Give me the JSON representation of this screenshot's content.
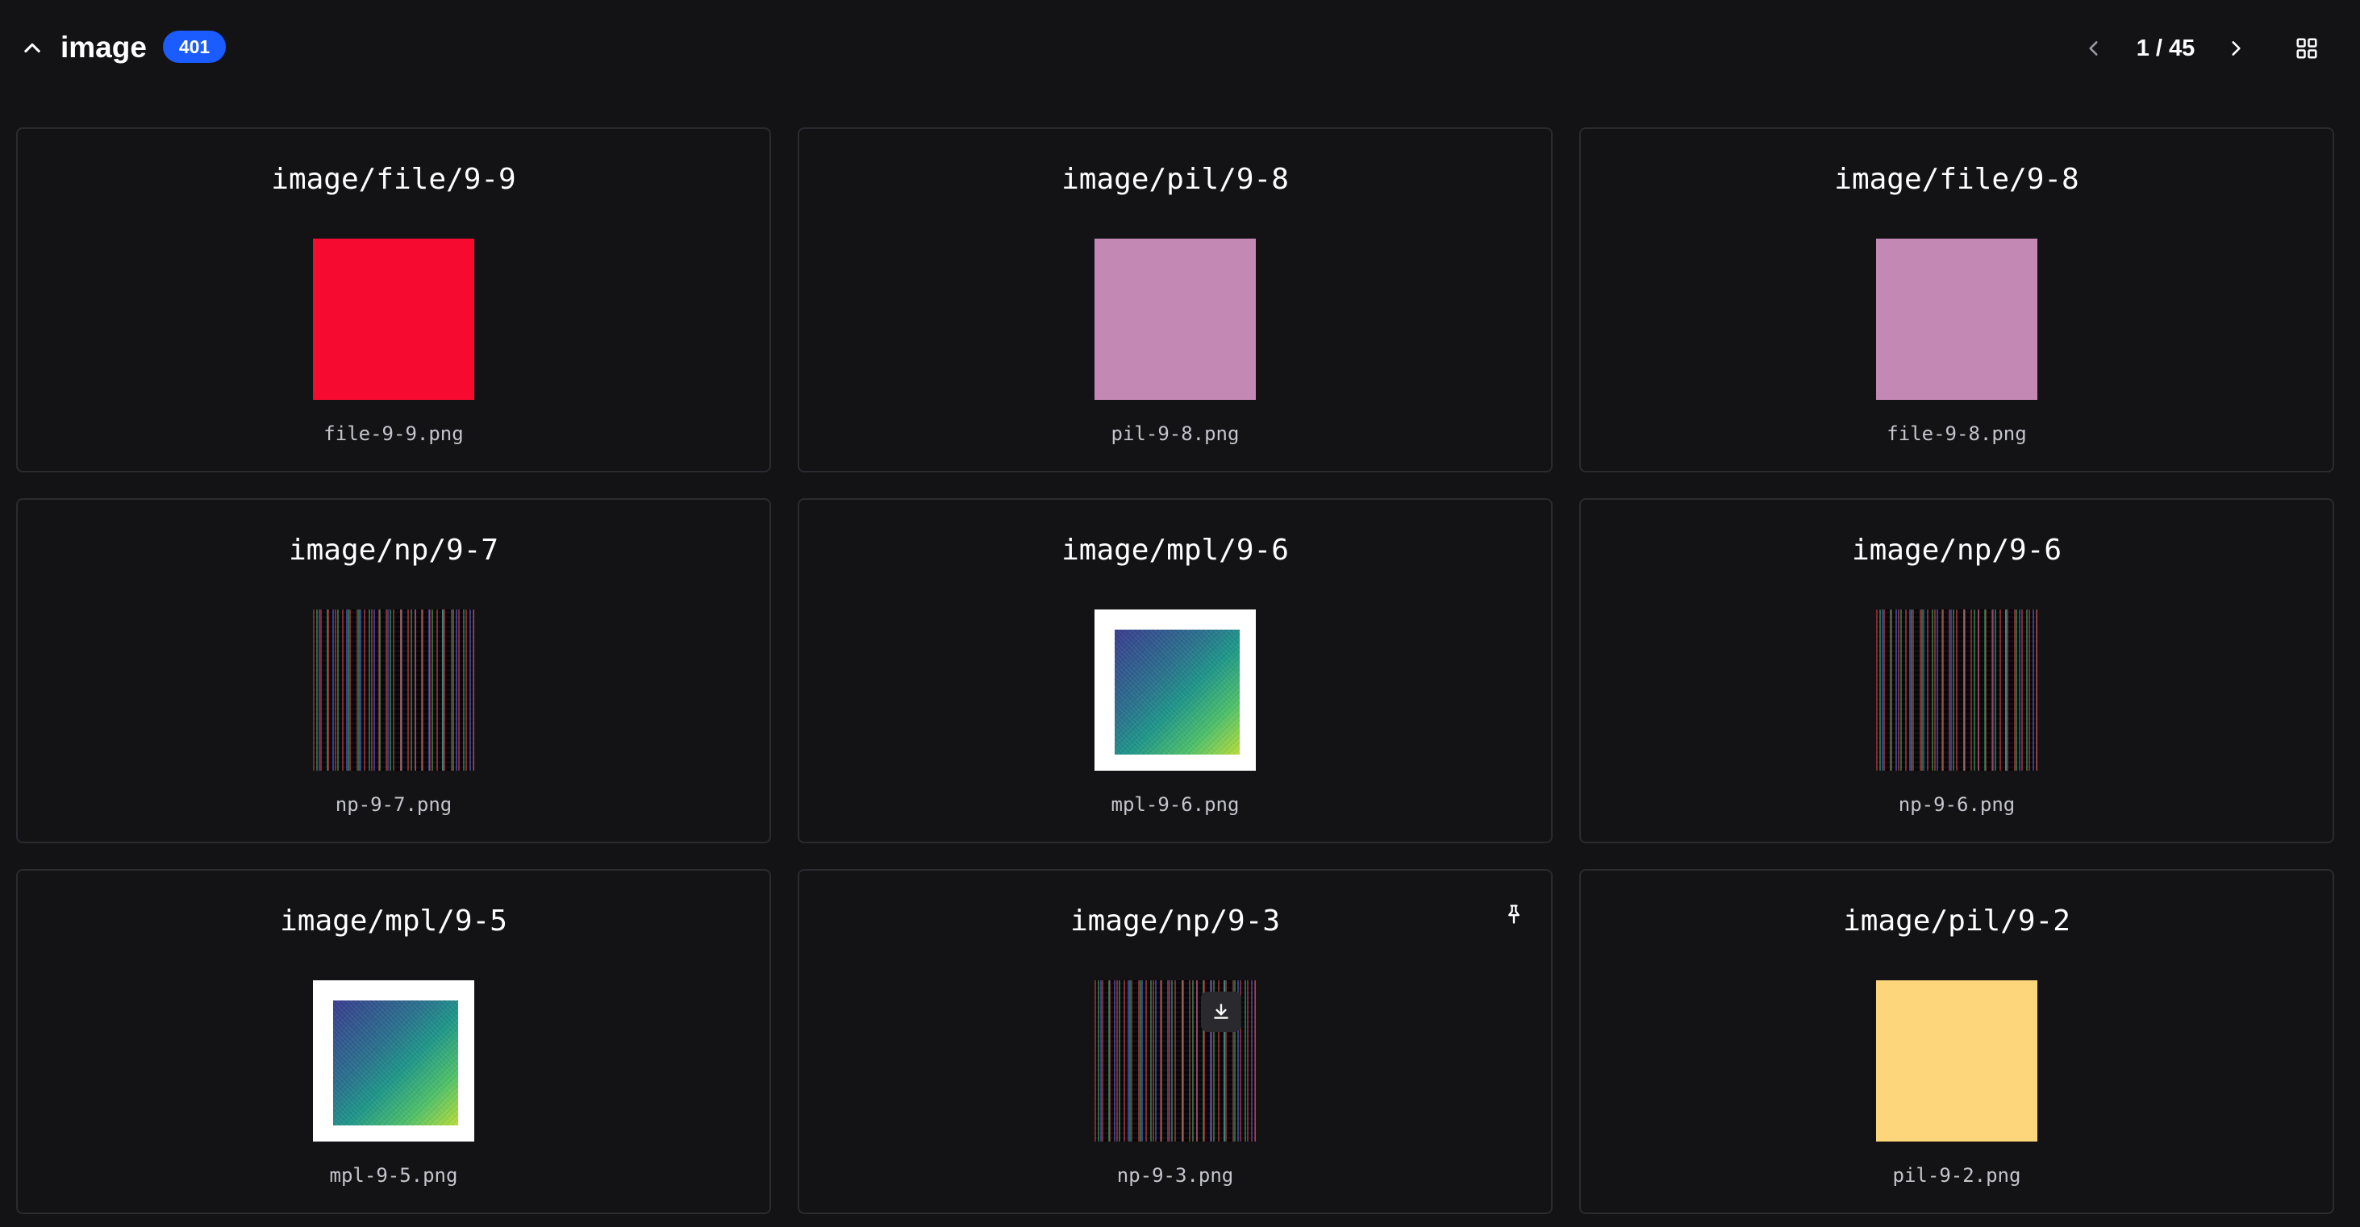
{
  "header": {
    "section_title": "image",
    "count": "401",
    "page_indicator": "1 / 45",
    "accent_color": "#1a5cff"
  },
  "icons": {
    "collapse": "chevron-up-icon",
    "prev": "chevron-left-icon",
    "next": "chevron-right-icon",
    "layout": "grid-icon",
    "pin": "pin-icon",
    "download": "download-icon"
  },
  "cards": [
    {
      "title": "image/file/9-9",
      "caption": "file-9-9.png",
      "kind": "solid",
      "color": "#f70a30"
    },
    {
      "title": "image/pil/9-8",
      "caption": "pil-9-8.png",
      "kind": "solid",
      "color": "#c488b5"
    },
    {
      "title": "image/file/9-8",
      "caption": "file-9-8.png",
      "kind": "solid",
      "color": "#c488b5"
    },
    {
      "title": "image/np/9-7",
      "caption": "np-9-7.png",
      "kind": "noise"
    },
    {
      "title": "image/mpl/9-6",
      "caption": "mpl-9-6.png",
      "kind": "plot"
    },
    {
      "title": "image/np/9-6",
      "caption": "np-9-6.png",
      "kind": "noise"
    },
    {
      "title": "image/mpl/9-5",
      "caption": "mpl-9-5.png",
      "kind": "plot"
    },
    {
      "title": "image/np/9-3",
      "caption": "np-9-3.png",
      "kind": "noise",
      "pinned_hover": true
    },
    {
      "title": "image/pil/9-2",
      "caption": "pil-9-2.png",
      "kind": "solid",
      "color": "#fdd57a"
    }
  ]
}
